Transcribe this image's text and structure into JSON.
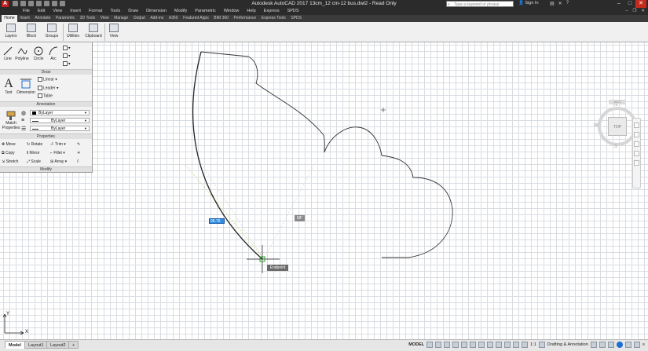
{
  "window": {
    "title": "Autodesk AutoCAD 2017   13cm_12 cm-12 bus.dwl2 - Read Only",
    "search_placeholder": "Type a keyword or phrase",
    "sign_in": "Sign In"
  },
  "menu": [
    "File",
    "Edit",
    "View",
    "Insert",
    "Format",
    "Tools",
    "Draw",
    "Dimension",
    "Modify",
    "Parametric",
    "Window",
    "Help",
    "Express",
    "SPDS"
  ],
  "ribbon_tabs": [
    "Home",
    "Insert",
    "Annotate",
    "Parametric",
    "3D Tools",
    "View",
    "Manage",
    "Output",
    "Add-ins",
    "A360",
    "Featured Apps",
    "BIM 360",
    "Performance",
    "Express Tools",
    "SPDS"
  ],
  "active_tab": "Home",
  "ribbon_buttons": [
    "Layers",
    "Block",
    "Groups",
    "Utilities",
    "Clipboard",
    "View"
  ],
  "draw_panel": {
    "title": "Draw",
    "tools": [
      "Line",
      "Polyline",
      "Circle",
      "Arc"
    ]
  },
  "annotation_panel": {
    "title": "Annotation",
    "text": "Text",
    "dimension": "Dimension",
    "linear": "Linear",
    "leader": "Leader",
    "table": "Table"
  },
  "properties_panel": {
    "title": "Properties",
    "match_properties": "Match Properties",
    "color": "ByLayer",
    "linetype": "ByLayer",
    "lineweight": "ByLayer"
  },
  "modify_panel": {
    "title": "Modify",
    "tools": [
      "Move",
      "Rotate",
      "Trim",
      "Copy",
      "Mirror",
      "Fillet",
      "Stretch",
      "Scale",
      "Array"
    ]
  },
  "viewcube": {
    "face": "TOP",
    "north": "N",
    "south": "S",
    "east": "E",
    "west": "W",
    "wcs": "WCS"
  },
  "dynamic_input": {
    "distance": "95.76",
    "angle": "58°",
    "snap": "Endpoint"
  },
  "ucs": {
    "x": "X",
    "y": "Y"
  },
  "layout_tabs": [
    "Model",
    "Layout1",
    "Layout2",
    "+"
  ],
  "status": {
    "model": "MODEL",
    "scale": "1:1",
    "workspace": "Drafting & Annotation"
  },
  "colors": {
    "ribbon_dark": "#2b2b2b",
    "accent_blue": "#2e8de4",
    "grid_line": "#d9dde2"
  }
}
